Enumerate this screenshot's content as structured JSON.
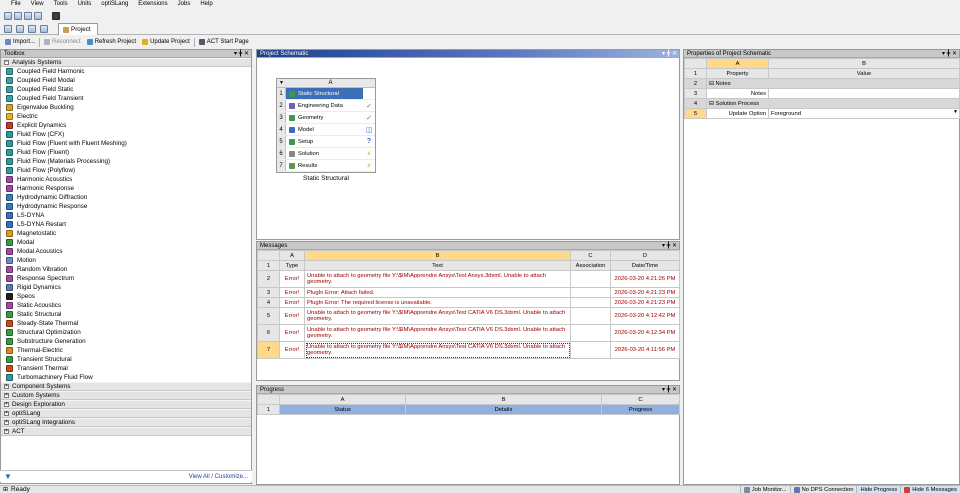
{
  "menu": [
    "File",
    "View",
    "Tools",
    "Units",
    "optiSLang",
    "Extensions",
    "Jobs",
    "Help"
  ],
  "tab": {
    "label": "Project"
  },
  "toolbar": {
    "import": "Import...",
    "reconnect": "Reconnect",
    "refresh": "Refresh Project",
    "update": "Update Project",
    "act": "ACT Start Page"
  },
  "toolbox": {
    "title": "Toolbox",
    "controls": "▾ ╋ ✕",
    "analysis_header": "Analysis Systems",
    "items": [
      {
        "label": "Coupled Field Harmonic",
        "color": "#3aa0a8"
      },
      {
        "label": "Coupled Field Modal",
        "color": "#3aa0a8"
      },
      {
        "label": "Coupled Field Static",
        "color": "#3aa0a8"
      },
      {
        "label": "Coupled Field Transient",
        "color": "#3aa0a8"
      },
      {
        "label": "Eigenvalue Buckling",
        "color": "#d0a030"
      },
      {
        "label": "Electric",
        "color": "#e3b12a"
      },
      {
        "label": "Explicit Dynamics",
        "color": "#c0392b"
      },
      {
        "label": "Fluid Flow (CFX)",
        "color": "#2e9a9a"
      },
      {
        "label": "Fluid Flow (Fluent with Fluent Meshing)",
        "color": "#2e9a9a"
      },
      {
        "label": "Fluid Flow (Fluent)",
        "color": "#2e9a9a"
      },
      {
        "label": "Fluid Flow (Materials Processing)",
        "color": "#2e9a9a"
      },
      {
        "label": "Fluid Flow (Polyflow)",
        "color": "#2e9a9a"
      },
      {
        "label": "Harmonic Acoustics",
        "color": "#a04aa0"
      },
      {
        "label": "Harmonic Response",
        "color": "#a04aa0"
      },
      {
        "label": "Hydrodynamic Diffraction",
        "color": "#2f7fc0"
      },
      {
        "label": "Hydrodynamic Response",
        "color": "#2f7fc0"
      },
      {
        "label": "LS-DYNA",
        "color": "#3a6cc8"
      },
      {
        "label": "LS-DYNA Restart",
        "color": "#3a6cc8"
      },
      {
        "label": "Magnetostatic",
        "color": "#d8a020"
      },
      {
        "label": "Modal",
        "color": "#3a9a48"
      },
      {
        "label": "Modal Acoustics",
        "color": "#a04aa0"
      },
      {
        "label": "Motion",
        "color": "#6a8ac8"
      },
      {
        "label": "Random Vibration",
        "color": "#a04aa0"
      },
      {
        "label": "Response Spectrum",
        "color": "#a04aa0"
      },
      {
        "label": "Rigid Dynamics",
        "color": "#5a7ab8"
      },
      {
        "label": "Speos",
        "color": "#202020"
      },
      {
        "label": "Static Acoustics",
        "color": "#a04aa0"
      },
      {
        "label": "Static Structural",
        "color": "#3a9a48"
      },
      {
        "label": "Steady-State Thermal",
        "color": "#c84a1a"
      },
      {
        "label": "Structural Optimization",
        "color": "#3a9a48"
      },
      {
        "label": "Substructure Generation",
        "color": "#3a9a48"
      },
      {
        "label": "Thermal-Electric",
        "color": "#d88a20"
      },
      {
        "label": "Transient Structural",
        "color": "#3a9a48"
      },
      {
        "label": "Transient Thermal",
        "color": "#c84a1a"
      },
      {
        "label": "Turbomachinery Fluid Flow",
        "color": "#2e9a9a"
      }
    ],
    "categories": [
      "Component Systems",
      "Custom Systems",
      "Design Exploration",
      "optiSLang",
      "optiSLang Integrations",
      "ACT"
    ],
    "footer_link": "View All / Customize..."
  },
  "schematic": {
    "title": "Project Schematic",
    "controls": "▾ ╋ ✕",
    "col": "A",
    "rows": [
      {
        "n": "1",
        "label": "Static Structural",
        "status": "",
        "color": "#3a9a48"
      },
      {
        "n": "2",
        "label": "Engineering Data",
        "status": "✓",
        "color": "#7a5ab8"
      },
      {
        "n": "3",
        "label": "Geometry",
        "status": "✓",
        "color": "#3a9a48"
      },
      {
        "n": "4",
        "label": "Model",
        "status": "◫",
        "color": "#3a6cc8"
      },
      {
        "n": "5",
        "label": "Setup",
        "status": "?",
        "color": "#3a9a48"
      },
      {
        "n": "6",
        "label": "Solution",
        "status": "⚡",
        "color": "#888888"
      },
      {
        "n": "7",
        "label": "Results",
        "status": "⚡",
        "color": "#5a9a48"
      }
    ],
    "system_label": "Static Structural"
  },
  "messages": {
    "title": "Messages",
    "controls": "▾ ╋ ✕",
    "cols": [
      "A",
      "B",
      "C",
      "D"
    ],
    "headers": [
      "Type",
      "Text",
      "Association",
      "Date/Time"
    ],
    "rows": [
      {
        "n": "2",
        "type": "Error!",
        "text": "Unable to attach to geometry file Y:\\$IM\\Apprendre Ansys\\Test Ansys.3dxml. Unable to attach geometry.",
        "assoc": "",
        "time": "2026-03-20 4:21:26 PM"
      },
      {
        "n": "3",
        "type": "Error!",
        "text": "PlugIn Error: Attach failed.",
        "assoc": "",
        "time": "2026-03-20 4:21:23 PM"
      },
      {
        "n": "4",
        "type": "Error!",
        "text": "PlugIn Error: The required license is unavailable.",
        "assoc": "",
        "time": "2026-03-20 4:21:23 PM"
      },
      {
        "n": "5",
        "type": "Error!",
        "text": "Unable to attach to geometry file Y:\\$IM\\Apprendre Ansys\\Test CATIA V6 DS.3dxml. Unable to attach geometry.",
        "assoc": "",
        "time": "2026-03-20 4:12:42 PM"
      },
      {
        "n": "6",
        "type": "Error!",
        "text": "Unable to attach to geometry file Y:\\$IM\\Apprendre Ansys\\Test CATIA V6 DS.3dxml. Unable to attach geometry.",
        "assoc": "",
        "time": "2026-03-20 4:12:34 PM"
      },
      {
        "n": "7",
        "type": "Error!",
        "text": "Unable to attach to geometry file Y:\\$IM\\Apprendre Ansys\\Test CATIA V6 DS.3dxml. Unable to attach geometry.",
        "assoc": "",
        "time": "2026-03-20 4:11:56 PM"
      }
    ]
  },
  "progress": {
    "title": "Progress",
    "controls": "▾ ╋ ✕",
    "cols": [
      "A",
      "B",
      "C"
    ],
    "headers": [
      "Status",
      "Details",
      "Progress"
    ]
  },
  "properties": {
    "title": "Properties of Project Schematic",
    "controls": "▾ ╋ ✕",
    "cols": [
      "A",
      "B"
    ],
    "headers": [
      "Property",
      "Value"
    ],
    "notes_group": "Notes",
    "notes": "Notes",
    "solution_group": "Solution Process",
    "update_option": "Update Option",
    "update_value": "Foreground"
  },
  "status": {
    "ready": "Ready",
    "job_monitor": "Job Monitor...",
    "dps": "No DPS Connection",
    "hide_progress": "Hide Progress",
    "hide_messages": "Hide 6 Messages"
  }
}
